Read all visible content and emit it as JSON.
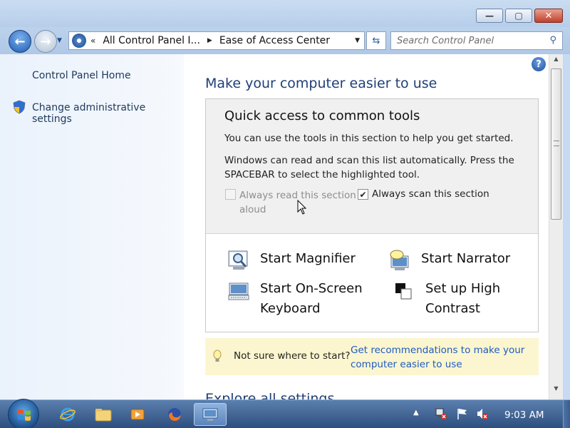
{
  "window": {
    "controls": {
      "minimize": "—",
      "maximize": "▢",
      "close": "✕"
    }
  },
  "navbar": {
    "back_icon": "back-arrow-icon",
    "forward_icon": "forward-arrow-icon",
    "overflow_chevron": "«",
    "breadcrumbs": [
      "All Control Panel I...",
      "Ease of Access Center"
    ],
    "search_placeholder": "Search Control Panel"
  },
  "sidebar": {
    "items": [
      {
        "label": "Control Panel Home"
      },
      {
        "label": "Change administrative settings",
        "icon": "uac-shield-icon"
      }
    ]
  },
  "main": {
    "heading": "Make your computer easier to use",
    "quick_access": {
      "title": "Quick access to common tools",
      "intro": "You can use the tools in this section to help you get started.",
      "scan_note": "Windows can read and scan this list automatically.  Press the SPACEBAR to select the highlighted tool.",
      "checkbox_read": {
        "label": "Always read this section aloud",
        "checked": false,
        "enabled": false
      },
      "checkbox_scan": {
        "label": "Always scan this section",
        "checked": true,
        "enabled": true
      },
      "tools": [
        {
          "label": "Start Magnifier",
          "icon": "magnifier-icon"
        },
        {
          "label": "Start Narrator",
          "icon": "narrator-icon"
        },
        {
          "label": "Start On-Screen Keyboard",
          "icon": "keyboard-icon"
        },
        {
          "label": "Set up High Contrast",
          "icon": "high-contrast-icon"
        }
      ]
    },
    "tip": {
      "question": "Not sure where to start?",
      "link": "Get recommendations to make your computer easier to use"
    },
    "next_heading_partial": "Explore all settings"
  },
  "taskbar": {
    "clock": "9:03 AM",
    "tray_arrow": "▲",
    "pinned": [
      "internet-explorer-icon",
      "windows-explorer-icon",
      "media-player-icon",
      "firefox-icon",
      "control-panel-icon"
    ]
  },
  "colors": {
    "link": "#1f5ac2",
    "heading": "#1e3f78",
    "tip_background": "#fbf6cf"
  }
}
